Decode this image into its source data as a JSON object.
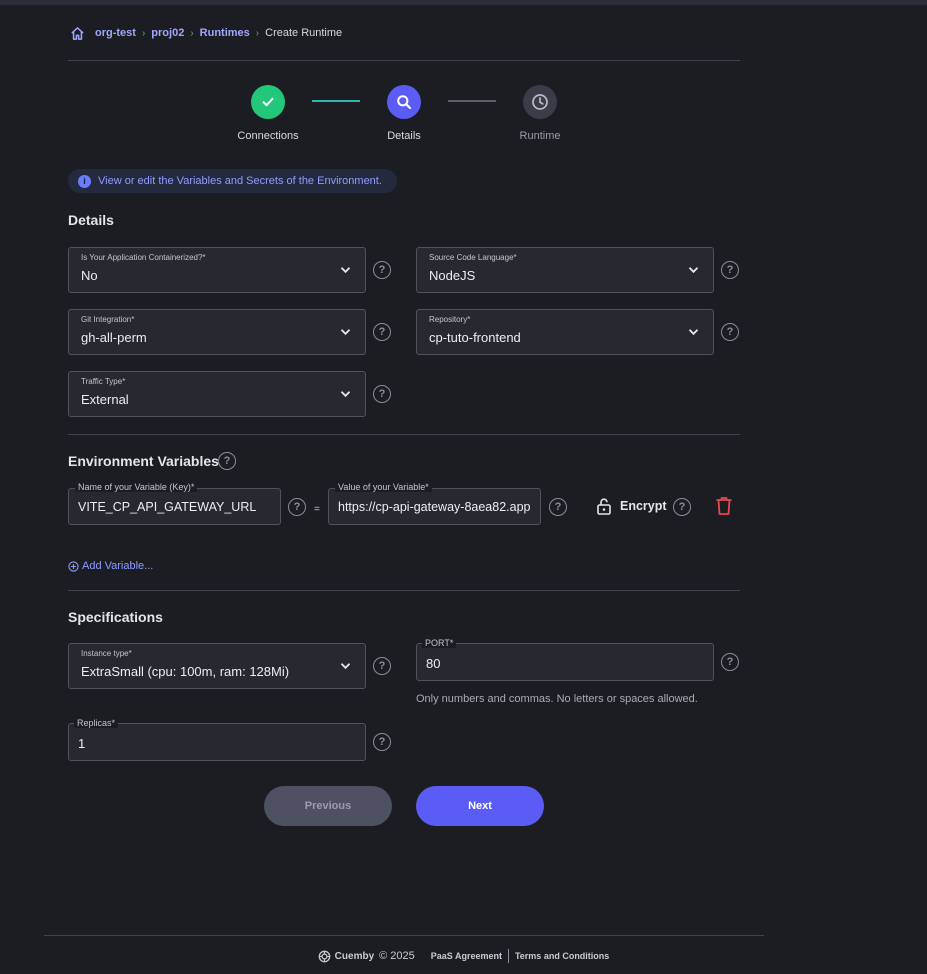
{
  "breadcrumb": {
    "items": [
      "org-test",
      "proj02",
      "Runtimes"
    ],
    "current": "Create Runtime"
  },
  "stepper": {
    "steps": [
      {
        "label": "Connections",
        "state": "done",
        "icon": "check-icon"
      },
      {
        "label": "Details",
        "state": "active",
        "icon": "search-icon"
      },
      {
        "label": "Runtime",
        "state": "pending",
        "icon": "clock-icon"
      }
    ]
  },
  "info_banner": "View or edit the Variables and Secrets of the Environment.",
  "details": {
    "title": "Details",
    "containerized": {
      "label": "Is Your Application Containerized?*",
      "value": "No"
    },
    "language": {
      "label": "Source Code Language*",
      "value": "NodeJS"
    },
    "git": {
      "label": "Git Integration*",
      "value": "gh-all-perm"
    },
    "repository": {
      "label": "Repository*",
      "value": "cp-tuto-frontend"
    },
    "traffic": {
      "label": "Traffic Type*",
      "value": "External"
    }
  },
  "env": {
    "title": "Environment Variables",
    "key_label": "Name of your Variable (Key)*",
    "key_value": "VITE_CP_API_GATEWAY_URL",
    "equals": "=",
    "value_label": "Value of your Variable*",
    "value_value": "https://cp-api-gateway-8aea82.app",
    "encrypt_label": "Encrypt",
    "add_label": "Add Variable..."
  },
  "specs": {
    "title": "Specifications",
    "instance": {
      "label": "Instance type*",
      "value": "ExtraSmall (cpu: 100m, ram: 128Mi)"
    },
    "port": {
      "label": "PORT*",
      "value": "80"
    },
    "port_hint": "Only numbers and commas. No letters or spaces allowed.",
    "replicas": {
      "label": "Replicas*",
      "value": "1"
    }
  },
  "buttons": {
    "previous": "Previous",
    "next": "Next"
  },
  "footer": {
    "brand": "Cuemby",
    "copyright": "© 2025",
    "paas": "PaaS Agreement",
    "terms": "Terms and Conditions"
  },
  "colors": {
    "background": "#1b1d23",
    "accent": "#5b5cf6",
    "success": "#22c77a",
    "danger": "#e5484d",
    "link": "#9fa7ff"
  }
}
